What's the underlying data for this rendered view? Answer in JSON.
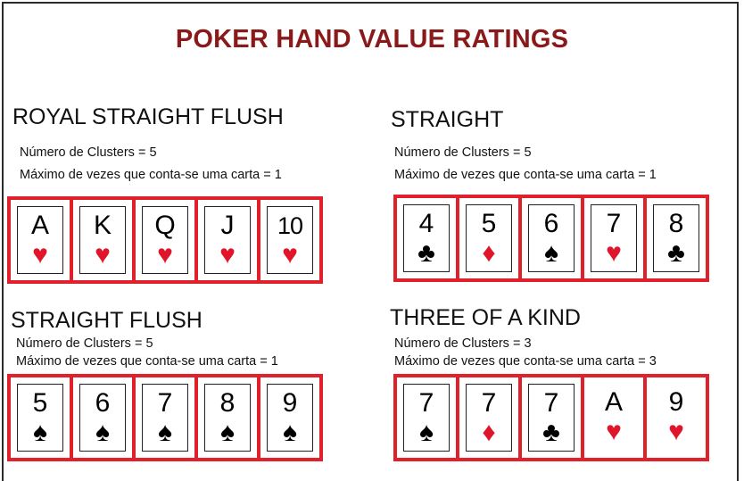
{
  "title": "POKER HAND VALUE RATINGS",
  "colors": {
    "title": "#8a1a1a",
    "slot_border": "#e0202a",
    "red_suit": "#e0152a"
  },
  "hands": [
    {
      "name": "ROYAL STRAIGHT FLUSH",
      "clusters": "Número de Clusters = 5",
      "max": "Máximo de vezes que conta-se uma carta = 1",
      "cards": [
        {
          "rank": "A",
          "suit": "♥",
          "color": "red"
        },
        {
          "rank": "K",
          "suit": "♥",
          "color": "red"
        },
        {
          "rank": "Q",
          "suit": "♥",
          "color": "red"
        },
        {
          "rank": "J",
          "suit": "♥",
          "color": "red"
        },
        {
          "rank": "10",
          "suit": "♥",
          "color": "red"
        }
      ]
    },
    {
      "name": "STRAIGHT",
      "clusters": "Número de Clusters = 5",
      "max": "Máximo de vezes que conta-se uma carta = 1",
      "cards": [
        {
          "rank": "4",
          "suit": "♣",
          "color": "black"
        },
        {
          "rank": "5",
          "suit": "♦",
          "color": "red"
        },
        {
          "rank": "6",
          "suit": "♠",
          "color": "black"
        },
        {
          "rank": "7",
          "suit": "♥",
          "color": "red"
        },
        {
          "rank": "8",
          "suit": "♣",
          "color": "black"
        }
      ]
    },
    {
      "name": "STRAIGHT FLUSH",
      "clusters": "Número de Clusters = 5",
      "max": "Máximo de vezes que conta-se uma carta = 1",
      "cards": [
        {
          "rank": "5",
          "suit": "♠",
          "color": "black"
        },
        {
          "rank": "6",
          "suit": "♠",
          "color": "black"
        },
        {
          "rank": "7",
          "suit": "♠",
          "color": "black"
        },
        {
          "rank": "8",
          "suit": "♠",
          "color": "black"
        },
        {
          "rank": "9",
          "suit": "♠",
          "color": "black"
        }
      ]
    },
    {
      "name": "THREE OF A KIND",
      "clusters": "Número de Clusters = 3",
      "max": "Máximo de vezes que conta-se uma carta = 3",
      "cards": [
        {
          "rank": "7",
          "suit": "♠",
          "color": "black"
        },
        {
          "rank": "7",
          "suit": "♦",
          "color": "red"
        },
        {
          "rank": "7",
          "suit": "♣",
          "color": "black"
        },
        {
          "rank": "A",
          "suit": "♥",
          "color": "red",
          "noframe": true
        },
        {
          "rank": "9",
          "suit": "♥",
          "color": "red",
          "noframe": true
        }
      ]
    }
  ]
}
